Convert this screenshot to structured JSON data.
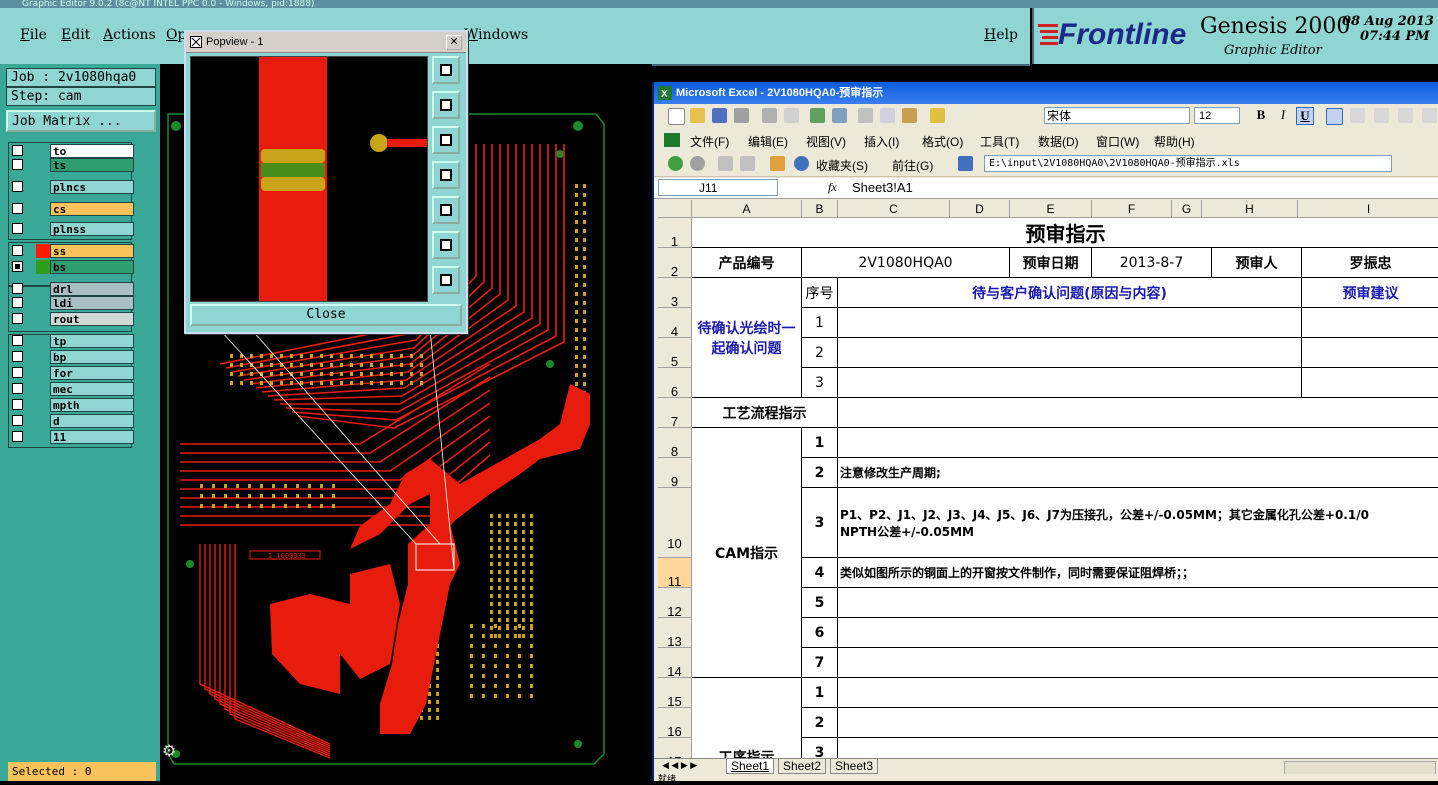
{
  "genesis": {
    "window_title": "Graphic Editor 9.0.2 (8c@NT INTEL PPC 0.0 - Windows, pid:1888)",
    "menu": [
      "File",
      "Edit",
      "Actions",
      "Op",
      "Windows",
      "Help"
    ],
    "logo_text": "Frontline",
    "product": "Genesis 2000",
    "product_sub": "Graphic Editor",
    "date": "08 Aug 2013",
    "time": "07:44 PM",
    "job_label": "Job : 2v1080hqa0",
    "step_label": "Step: cam",
    "job_matrix_button": "Job Matrix ...",
    "selected_label": "Selected : 0",
    "layers": [
      {
        "name": "to",
        "color": "#ffffff",
        "swatch": "",
        "checked": false
      },
      {
        "name": "ts",
        "color": "#2f9e6e",
        "swatch": "",
        "checked": false
      },
      {
        "name": "plncs",
        "color": "#8fd6d2",
        "swatch": "",
        "checked": false
      },
      {
        "name": "cs",
        "color": "#f9c25a",
        "swatch": "",
        "checked": false
      },
      {
        "name": "plnss",
        "color": "#8fd6d2",
        "swatch": "",
        "checked": false
      },
      {
        "name": "ss",
        "color": "#f9c25a",
        "swatch": "#ff1a00",
        "checked": false
      },
      {
        "name": "bs",
        "color": "#2f9e6e",
        "swatch": "#2e9e1f",
        "checked": true
      },
      {
        "name": "drl",
        "color": "#a8c0c4",
        "swatch": "",
        "checked": false
      },
      {
        "name": "ldi",
        "color": "#a8c0c4",
        "swatch": "",
        "checked": false
      },
      {
        "name": "rout",
        "color": "#d0d8d8",
        "swatch": "",
        "checked": false
      },
      {
        "name": "tp",
        "color": "#8fd6d2",
        "swatch": "",
        "checked": false
      },
      {
        "name": "bp",
        "color": "#8fd6d2",
        "swatch": "",
        "checked": false
      },
      {
        "name": "for",
        "color": "#8fd6d2",
        "swatch": "",
        "checked": false
      },
      {
        "name": "mec",
        "color": "#8fd6d2",
        "swatch": "",
        "checked": false
      },
      {
        "name": "mpth",
        "color": "#8fd6d2",
        "swatch": "",
        "checked": false
      },
      {
        "name": "d",
        "color": "#8fd6d2",
        "swatch": "",
        "checked": false
      },
      {
        "name": "11",
        "color": "#8fd6d2",
        "swatch": "",
        "checked": false
      }
    ],
    "board_label": "I_1000033"
  },
  "popview": {
    "title": "Popview - 1",
    "close_label": "Close"
  },
  "excel": {
    "title": "Microsoft Excel - 2V1080HQA0-预审指示",
    "menu": [
      "文件(F)",
      "编辑(E)",
      "视图(V)",
      "插入(I)",
      "格式(O)",
      "工具(T)",
      "数据(D)",
      "窗口(W)",
      "帮助(H)"
    ],
    "font_name": "宋体",
    "font_size": "12",
    "favorites": "收藏夹(S)",
    "goto": "前往(G)",
    "address": "E:\\input\\2V1080HQA0\\2V1080HQA0-预审指示.xls",
    "name_box": "J11",
    "formula": "Sheet3!A1",
    "columns": [
      "A",
      "B",
      "C",
      "D",
      "E",
      "F",
      "G",
      "H",
      "I"
    ],
    "rows": [
      "1",
      "2",
      "3",
      "4",
      "5",
      "6",
      "7",
      "8",
      "9",
      "10",
      "11",
      "12",
      "13",
      "14",
      "15",
      "16",
      "17"
    ],
    "cells": {
      "title": "预审指示",
      "product_no_label": "产品编号",
      "product_no": "2V1080HQA0",
      "review_date_label": "预审日期",
      "review_date": "2013-8-7",
      "reviewer_label": "预审人",
      "reviewer": "罗振忠",
      "confirm_label": "待确认光绘时一起确认问题",
      "seq_label": "序号",
      "issue_header": "待与客户确认问题(原因与内容)",
      "suggest_header": "预审建议",
      "n1": "1",
      "n2": "2",
      "n3": "3",
      "flow_label": "工艺流程指示",
      "cam_label": "CAM指示",
      "cam_n1": "1",
      "cam_n2": "2",
      "cam_n3": "3",
      "cam_n4": "4",
      "cam_n5": "5",
      "cam_n6": "6",
      "cam_n7": "7",
      "cam_2": "注意修改生产周期;",
      "cam_3a": "P1、P2、J1、J2、J3、J4、J5、J6、J7为压接孔，公差+/-0.05MM；其它金属化孔公差+0.1/0",
      "cam_3b": "NPTH公差+/-0.05MM",
      "cam_4": "类似如图所示的铜面上的开窗按文件制作，同时需要保证阻焊桥；；",
      "proc_label": "工序指示",
      "proc_n1": "1",
      "proc_n2": "2",
      "proc_n3": "3"
    },
    "sheets": [
      "Sheet1",
      "Sheet2",
      "Sheet3"
    ],
    "status": "就绪"
  }
}
